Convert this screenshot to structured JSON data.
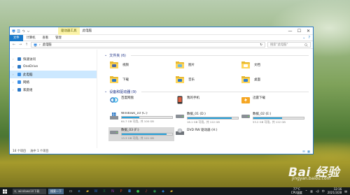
{
  "window": {
    "ribbon_context_tab": "驱动器工具",
    "title": "此电脑",
    "min_label": "—",
    "max_label": "☐",
    "close_label": "✕"
  },
  "ribbon": {
    "tabs": [
      "文件",
      "计算机",
      "查看",
      "管理"
    ],
    "expand_label": "⌄",
    "help_label": "?"
  },
  "address": {
    "back": "←",
    "forward": "→",
    "up": "↑",
    "path": "此电脑",
    "refresh": "↻",
    "search_placeholder": "搜索\"此电脑\""
  },
  "nav_pane": {
    "items": [
      {
        "label": "快速访问",
        "icon": "star-icon",
        "icon_color": "#2b78c6",
        "selected": false
      },
      {
        "label": "OneDrive",
        "icon": "cloud-icon",
        "icon_color": "#2b78c6",
        "selected": false
      },
      {
        "label": "此电脑",
        "icon": "computer-icon",
        "icon_color": "#3a8ee6",
        "selected": true
      },
      {
        "label": "网络",
        "icon": "network-icon",
        "icon_color": "#3a8ee6",
        "selected": false
      },
      {
        "label": "家庭组",
        "icon": "homegroup-icon",
        "icon_color": "#2b78c6",
        "selected": false
      }
    ]
  },
  "folders_group": {
    "header": "文件夹 (6)",
    "items": [
      {
        "label": "视频",
        "badge_color": "#4a6aa5"
      },
      {
        "label": "图片",
        "badge_color": "#6fb7e0"
      },
      {
        "label": "文档",
        "badge_color": "#ffffff"
      },
      {
        "label": "下载",
        "badge_color": "#2b78c6"
      },
      {
        "label": "音乐",
        "badge_color": "#2b78c6"
      },
      {
        "label": "桌面",
        "badge_color": "#2f7fd0"
      }
    ]
  },
  "devices_group": {
    "header": "设备和驱动器 (9)",
    "items": [
      {
        "name": "百度网盘",
        "icon": "baidu-cloud-icon",
        "has_bar": false,
        "free": ""
      },
      {
        "name": "我的手机",
        "icon": "phone-icon",
        "has_bar": false,
        "free": ""
      },
      {
        "name": "迅雷下载",
        "icon": "thunder-icon",
        "has_bar": false,
        "free": ""
      },
      {
        "name": "Windows_10 (C:)",
        "icon": "windows-drive-icon",
        "has_bar": true,
        "used": 0.35,
        "free": "64.7 GB 可用，共 100 GB"
      },
      {
        "name": "数据_01 (D:)",
        "icon": "hdd-icon",
        "has_bar": true,
        "used": 0.87,
        "free": "16.1 GB 可用，共 122 GB"
      },
      {
        "name": "数据_02 (E:)",
        "icon": "hdd-icon",
        "has_bar": true,
        "used": 0.57,
        "free": "53.2 GB 可用，共 122 GB"
      },
      {
        "name": "数据_03 (F:)",
        "icon": "hdd-icon",
        "has_bar": true,
        "used": 0.89,
        "free": "13.3 GB 可用，共 121 GB",
        "selected": true
      },
      {
        "name": "DVD RW 驱动器 (H:)",
        "icon": "dvd-drive-icon",
        "has_bar": false,
        "free": ""
      }
    ]
  },
  "status": {
    "count": "14 个项目",
    "selected": "选中 1 个项目",
    "view_details": "☷",
    "view_tiles": "▦"
  },
  "taskbar": {
    "search_text": "windows10下载",
    "button_label": "搜索一下",
    "tray_temp": "77°C",
    "tray_cpu": "CPU温度",
    "tray_lang": "中",
    "time": "12:16",
    "date": "2021/3/28"
  },
  "watermark": {
    "logo": "Bai 经验",
    "site": "jingyan.baidu.com"
  },
  "colors": {
    "accent": "#1979ca",
    "bar_fill": "#26a0da",
    "selection": "#cce8ff"
  }
}
